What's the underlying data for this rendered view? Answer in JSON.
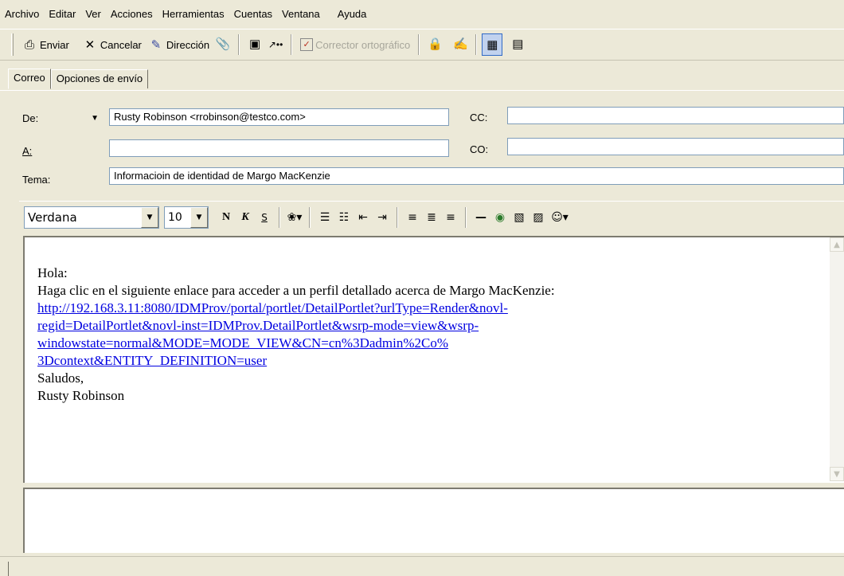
{
  "menu": [
    "Archivo",
    "Editar",
    "Ver",
    "Acciones",
    "Herramientas",
    "Cuentas",
    "Ventana",
    "Ayuda"
  ],
  "toolbar": {
    "send_label": "Enviar",
    "cancel_label": "Cancelar",
    "address_label": "Dirección",
    "spell_label": "Corrector ortográfico"
  },
  "tabs": [
    "Correo",
    "Opciones de envío"
  ],
  "from": {
    "label": "De:",
    "value": "Rusty Robinson <rrobinson@testco.com>"
  },
  "to": {
    "label": "A:",
    "value": ""
  },
  "cc": {
    "label": "CC:",
    "value": ""
  },
  "bcc": {
    "label": "CO:",
    "value": ""
  },
  "subject": {
    "label": "Tema:",
    "value": "Informacioin de identidad de Margo MacKenzie"
  },
  "format": {
    "font": "Verdana",
    "size": "10",
    "bold": "N",
    "italic": "K",
    "underline": "S"
  },
  "message": {
    "greeting": "Hola:",
    "intro": "Haga clic en el siguiente enlace para acceder a un perfil detallado acerca de Margo MacKenzie:",
    "link_lines": [
      "http://192.168.3.11:8080/IDMProv/portal/portlet/DetailPortlet?urlType=Render&novl-",
      "regid=DetailPortlet&novl-inst=IDMProv.DetailPortlet&wsrp-mode=view&wsrp-",
      "windowstate=normal&MODE=MODE_VIEW&CN=cn%3Dadmin%2Co%",
      "3Dcontext&ENTITY_DEFINITION=user"
    ],
    "closing": "Saludos,",
    "signature": "Rusty Robinson"
  }
}
